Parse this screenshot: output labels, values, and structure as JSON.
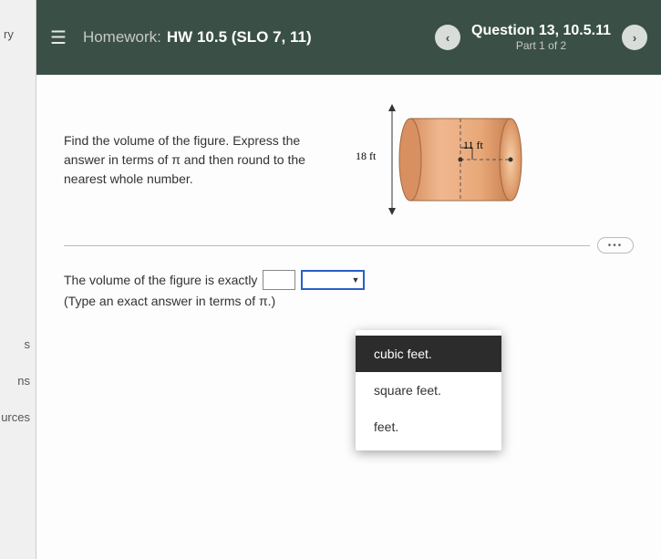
{
  "leftNav": {
    "top": "ry",
    "mid1": "s",
    "mid2": "ns",
    "mid3": "urces"
  },
  "header": {
    "hwLabel": "Homework:",
    "hwTitle": "HW 10.5 (SLO 7, 11)",
    "prevIcon": "‹",
    "nextIcon": "›",
    "questionNum": "Question 13, 10.5.11",
    "partInfo": "Part 1 of 2"
  },
  "problem": {
    "text": "Find the volume of the figure. Express the answer in terms of π and then round to the nearest whole number.",
    "heightLabel": "18 ft",
    "radiusLabel": "11 ft"
  },
  "answer": {
    "prompt": "The volume of the figure is exactly",
    "hint": "(Type an exact answer in terms of π.)"
  },
  "dropdown": {
    "options": [
      "cubic feet.",
      "square feet.",
      "feet."
    ],
    "selectedIndex": 0
  },
  "dotsLabel": "•••"
}
